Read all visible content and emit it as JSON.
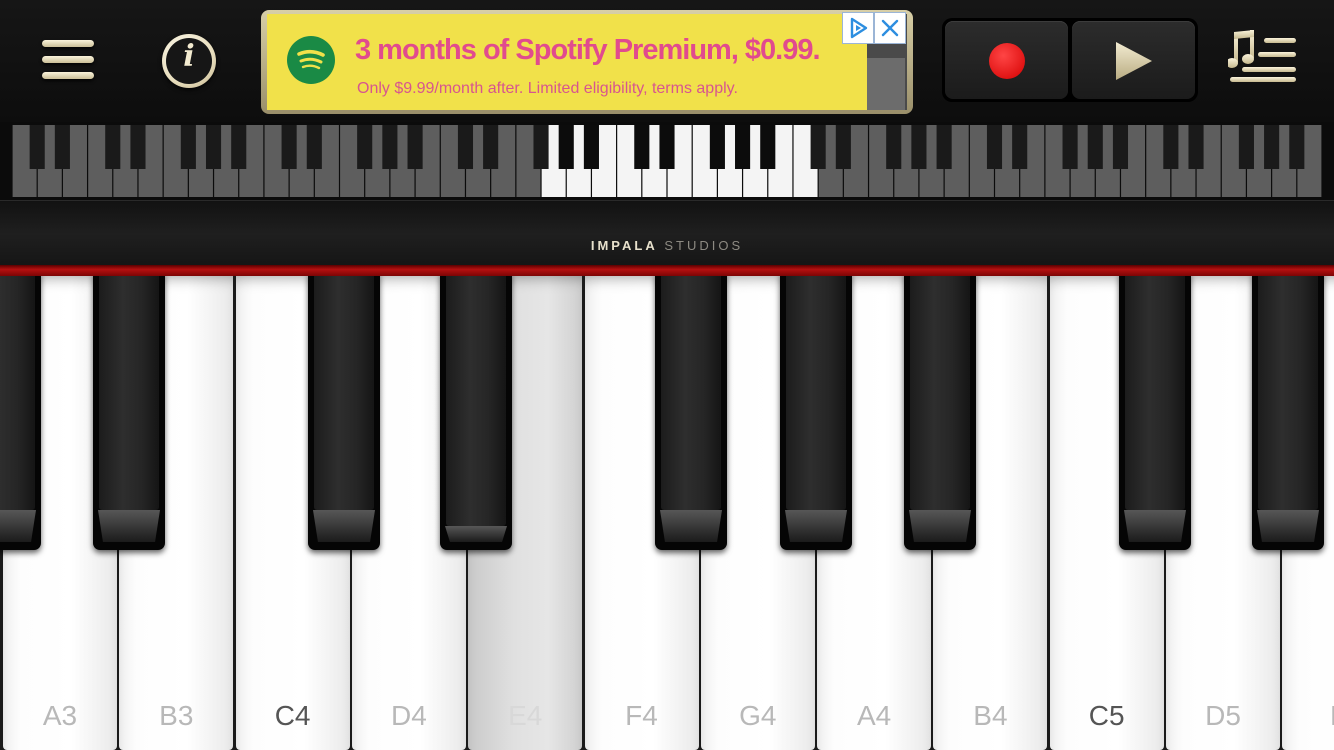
{
  "brand": {
    "name_bold": "IMPALA",
    "name_light": "STUDIOS"
  },
  "ad": {
    "headline": "3 months of Spotify Premium, $0.99.",
    "subtext": "Only $9.99/month after. Limited eligibility, terms apply.",
    "logo_icon": "spotify-icon",
    "background_color": "#f1e14a",
    "text_color": "#e14b8e"
  },
  "toolbar": {
    "menu_icon": "hamburger-menu-icon",
    "info_icon": "info-icon",
    "info_glyph": "i",
    "record_icon": "record-icon",
    "play_icon": "play-icon",
    "songs_icon": "music-list-icon",
    "record_color": "#e00000"
  },
  "keyboard": {
    "labels": [
      "A3",
      "B3",
      "C4",
      "D4",
      "E4",
      "F4",
      "G4",
      "A4",
      "B4",
      "C5",
      "D5",
      "E"
    ],
    "pressed_key": "E4"
  }
}
